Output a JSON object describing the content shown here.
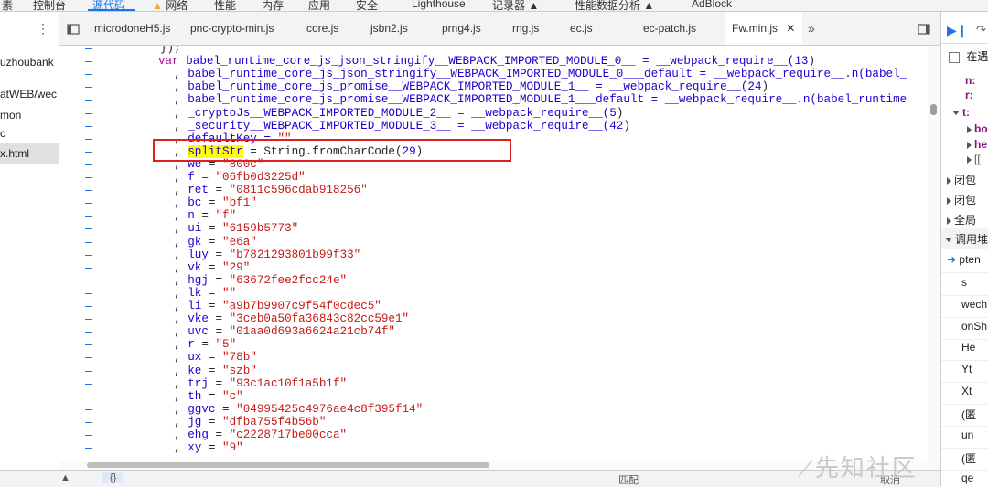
{
  "top_tabs": [
    {
      "label": "素"
    },
    {
      "label": "控制台"
    },
    {
      "label": "源代码"
    },
    {
      "label": "网络"
    },
    {
      "label": "性能"
    },
    {
      "label": "内存"
    },
    {
      "label": "应用"
    },
    {
      "label": "安全"
    },
    {
      "label": "Lighthouse"
    },
    {
      "label": "记录器 ▲"
    },
    {
      "label": "性能数据分析 ▲"
    },
    {
      "label": "AdBlock"
    }
  ],
  "nav_items": [
    {
      "label": "uzhoubank"
    },
    {
      "label": "atWEB/wec"
    },
    {
      "label": "mon"
    },
    {
      "label": "c"
    },
    {
      "label": "x.html"
    }
  ],
  "file_tabs": [
    {
      "label": "microdoneH5.js"
    },
    {
      "label": "pnc-crypto-min.js"
    },
    {
      "label": "core.js"
    },
    {
      "label": "jsbn2.js"
    },
    {
      "label": "prng4.js"
    },
    {
      "label": "rng.js"
    },
    {
      "label": "ec.js"
    },
    {
      "label": "ec-patch.js"
    },
    {
      "label": "Fw.min.js"
    }
  ],
  "code_lines": [
    {
      "pre": "});",
      "a": "",
      "b": "",
      "c": "",
      "kind": "p"
    },
    {
      "pre": "",
      "a": "var",
      "b": " babel_runtime_core_js_json_stringify__WEBPACK_IMPORTED_MODULE_0__ = __webpack_require__(",
      "c": "13",
      "kind": "kw"
    },
    {
      "pre": "  , ",
      "a": "babel_runtime_core_js_json_stringify__WEBPACK_IMPORTED_MODULE_0___default = __webpack_require__.n(babel_",
      "b": "",
      "c": "",
      "kind": "p"
    },
    {
      "pre": "  , ",
      "a": "babel_runtime_core_js_promise__WEBPACK_IMPORTED_MODULE_1__ = __webpack_require__(",
      "b": "24",
      "c": ")",
      "kind": "num"
    },
    {
      "pre": "  , ",
      "a": "babel_runtime_core_js_promise__WEBPACK_IMPORTED_MODULE_1___default = __webpack_require__.n(babel_runtime",
      "b": "",
      "c": "",
      "kind": "p"
    },
    {
      "pre": "  , ",
      "a": "_cryptoJs__WEBPACK_IMPORTED_MODULE_2__ = __webpack_require__(",
      "b": "5",
      "c": ")",
      "kind": "num"
    },
    {
      "pre": "  , ",
      "a": "_security__WEBPACK_IMPORTED_MODULE_3__ = __webpack_require__(",
      "b": "42",
      "c": ")",
      "kind": "num"
    },
    {
      "pre": "  , ",
      "a": "defaultKey = ",
      "b": "\"\"",
      "c": "",
      "kind": "str"
    }
  ],
  "split_line": {
    "pre": "  , ",
    "name": "splitStr",
    "rest": " = String.fromCharCode(",
    "num": "29",
    "close": ")"
  },
  "var_lines": [
    {
      "name": "we",
      "value": "\"800c\""
    },
    {
      "name": "f",
      "value": "\"06fb0d3225d\""
    },
    {
      "name": "ret",
      "value": "\"0811c596cdab918256\""
    },
    {
      "name": "bc",
      "value": "\"bf1\""
    },
    {
      "name": "n",
      "value": "\"f\""
    },
    {
      "name": "ui",
      "value": "\"6159b5773\""
    },
    {
      "name": "gk",
      "value": "\"e6a\""
    },
    {
      "name": "luy",
      "value": "\"b7821293801b99f33\""
    },
    {
      "name": "vk",
      "value": "\"29\""
    },
    {
      "name": "hgj",
      "value": "\"63672fee2fcc24e\""
    },
    {
      "name": "lk",
      "value": "\"\""
    },
    {
      "name": "li",
      "value": "\"a9b7b9907c9f54f0cdec5\""
    },
    {
      "name": "vke",
      "value": "\"3ceb0a50fa36843c82cc59e1\""
    },
    {
      "name": "uvc",
      "value": "\"01aa0d693a6624a21cb74f\""
    },
    {
      "name": "r",
      "value": "\"5\""
    },
    {
      "name": "ux",
      "value": "\"78b\""
    },
    {
      "name": "ke",
      "value": "\"szb\""
    },
    {
      "name": "trj",
      "value": "\"93c1ac10f1a5b1f\""
    },
    {
      "name": "th",
      "value": "\"c\""
    },
    {
      "name": "ggvc",
      "value": "\"04995425c4976ae4c8f395f14\""
    },
    {
      "name": "jg",
      "value": "\"dfba755f4b56b\""
    },
    {
      "name": "ehg",
      "value": "\"c2228717be00cca\""
    },
    {
      "name": "xy",
      "value": "\"9\""
    }
  ],
  "right_panel": {
    "pause_label": "在遇",
    "scope_n": "n:",
    "scope_r": "r:",
    "scope_t": "t:",
    "t_child1": "bo",
    "t_child2": "he",
    "t_child3": "[[",
    "closure1": "闭包",
    "closure2": "闭包",
    "global": "全局",
    "callstack_title": "调用堆",
    "stack": [
      "pten",
      "s",
      "wech",
      "onSh",
      "He",
      "Yt",
      "Xt",
      "(匿",
      "un",
      "(匿",
      "qe"
    ]
  },
  "bottom": {
    "left_label": "{}",
    "mid_label": "匹配",
    "right_label": "取消"
  },
  "watermark": "先知社区"
}
